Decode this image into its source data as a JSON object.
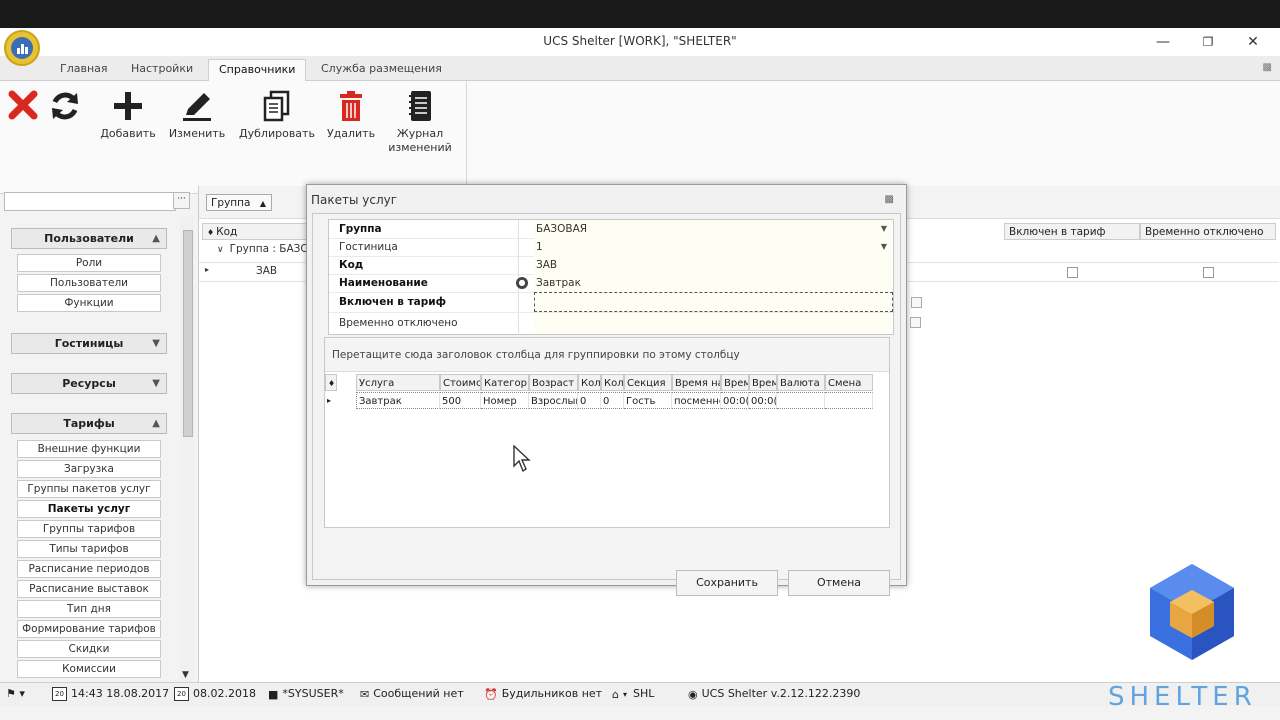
{
  "window": {
    "title": "UCS Shelter [WORK], \"SHELTER\""
  },
  "menu_tabs": [
    "Главная",
    "Настройки",
    "Справочники",
    "Служба размещения"
  ],
  "ribbon": {
    "add": "Добавить",
    "edit": "Изменить",
    "duplicate": "Дублировать",
    "delete": "Удалить",
    "log_line1": "Журнал",
    "log_line2": "изменений"
  },
  "sidebar": {
    "search_btn": "···",
    "users_head": "Пользователи",
    "users_items": [
      "Роли",
      "Пользователи",
      "Функции"
    ],
    "hotels_head": "Гостиницы",
    "resources_head": "Ресурсы",
    "tariffs_head": "Тарифы",
    "tariffs_items": [
      "Внешние функции",
      "Загрузка",
      "Группы пакетов услуг",
      "Пакеты услуг",
      "Группы тарифов",
      "Типы тарифов",
      "Расписание периодов",
      "Расписание выставок",
      "Тип дня",
      "Формирование тарифов",
      "Скидки",
      "Комиссии"
    ]
  },
  "main_grid": {
    "group_chip": "Группа",
    "col_code": "Код",
    "col_in_tariff": "Включен в тариф",
    "col_disabled": "Временно отключено",
    "group_row": "Группа : БАЗО",
    "row_code": "ЗАВ"
  },
  "modal": {
    "title": "Пакеты услуг",
    "props": {
      "group_label": "Группа",
      "group_value": "БАЗОВАЯ",
      "hotel_label": "Гостиница",
      "hotel_value": "1",
      "code_label": "Код",
      "code_value": "ЗАВ",
      "name_label": "Наименование",
      "name_value": "Завтрак",
      "in_tariff_label": "Включен в тариф",
      "disabled_label": "Временно отключено"
    },
    "group_hint": "Перетащите сюда заголовок столбца для группировки по этому столбцу",
    "columns": [
      "Услуга",
      "Стоимс",
      "Категор",
      "Возраст",
      "Кол",
      "Кол",
      "Секция",
      "Время на",
      "Врем",
      "Врем",
      "Валюта",
      "Смена"
    ],
    "row": [
      "Завтрак",
      "500",
      "Номер",
      "Взрослый",
      "0",
      "0",
      "Гость",
      "посменно",
      "00:0(",
      "00:0(",
      "",
      ""
    ],
    "save": "Сохранить",
    "cancel": "Отмена"
  },
  "status": {
    "time1": "14:43 18.08.2017",
    "date2": "08.02.2018",
    "user": "*SYSUSER*",
    "messages": "Сообщений нет",
    "alarms": "Будильников нет",
    "hotel": "SHL",
    "version": "UCS Shelter v.2.12.122.2390",
    "cal_day": "20"
  },
  "brand": "SHELTER",
  "colors": {
    "accent_red": "#d9281f",
    "brand_blue": "#5fa4e0"
  }
}
